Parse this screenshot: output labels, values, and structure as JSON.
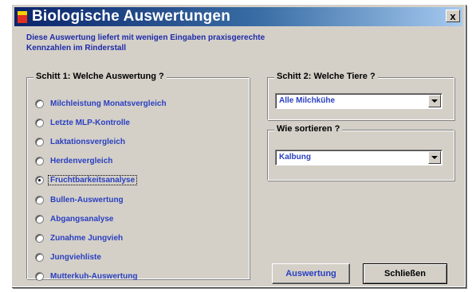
{
  "window": {
    "title": "Biologische Auswertungen",
    "close_label": "x",
    "description": "Diese Auswertung liefert mit wenigen Eingaben praxisgerechte\nKennzahlen im Rinderstall"
  },
  "step1": {
    "title": "Schitt 1: Welche Auswertung ?",
    "options": [
      {
        "label": "Milchleistung Monatsvergleich",
        "checked": false
      },
      {
        "label": "Letzte MLP-Kontrolle",
        "checked": false
      },
      {
        "label": "Laktationsvergleich",
        "checked": false
      },
      {
        "label": "Herdenvergleich",
        "checked": false
      },
      {
        "label": "Fruchtbarkeitsanalyse",
        "checked": true
      },
      {
        "label": "Bullen-Auswertung",
        "checked": false
      },
      {
        "label": "Abgangsanalyse",
        "checked": false
      },
      {
        "label": "Zunahme Jungvieh",
        "checked": false
      },
      {
        "label": "Jungviehliste",
        "checked": false
      },
      {
        "label": "Mutterkuh-Auswertung",
        "checked": false
      }
    ]
  },
  "step2": {
    "title": "Schitt 2:  Welche Tiere ?",
    "selected": "Alle Milchkühe"
  },
  "sort": {
    "title": "Wie sortieren ?",
    "selected": "Kalbung"
  },
  "buttons": {
    "auswertung": "Auswertung",
    "schliessen": "Schließen"
  },
  "colors": {
    "title_bar_start": "#0a246a",
    "title_bar_end": "#a6caf0",
    "label_blue": "#2a3fc0",
    "face": "#d4d0c8"
  },
  "icons": {
    "app": "app-window-icon",
    "close": "close-icon",
    "dropdown": "chevron-down-icon"
  }
}
